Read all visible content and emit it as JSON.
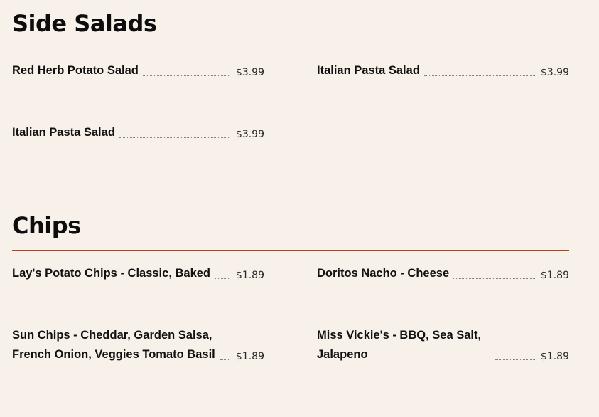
{
  "colors": {
    "background": "#f8f1ea",
    "rule": "#b5451b",
    "text": "#111111"
  },
  "sections": [
    {
      "title": "Side Salads",
      "items": [
        {
          "name": "Red Herb Potato Salad",
          "price": "$3.99"
        },
        {
          "name": "Italian Pasta Salad",
          "price": "$3.99"
        },
        {
          "name": "Italian Pasta Salad",
          "price": "$3.99"
        }
      ]
    },
    {
      "title": "Chips",
      "items": [
        {
          "name": "Lay's Potato Chips - Classic, Baked",
          "price": "$1.89"
        },
        {
          "name": "Doritos Nacho - Cheese",
          "price": "$1.89"
        },
        {
          "name": "Sun Chips - Cheddar, Garden Salsa, French Onion, Veggies Tomato Basil",
          "price": "$1.89"
        },
        {
          "name": "Miss Vickie's - BBQ, Sea Salt, Jalapeno",
          "price": "$1.89"
        }
      ]
    }
  ]
}
